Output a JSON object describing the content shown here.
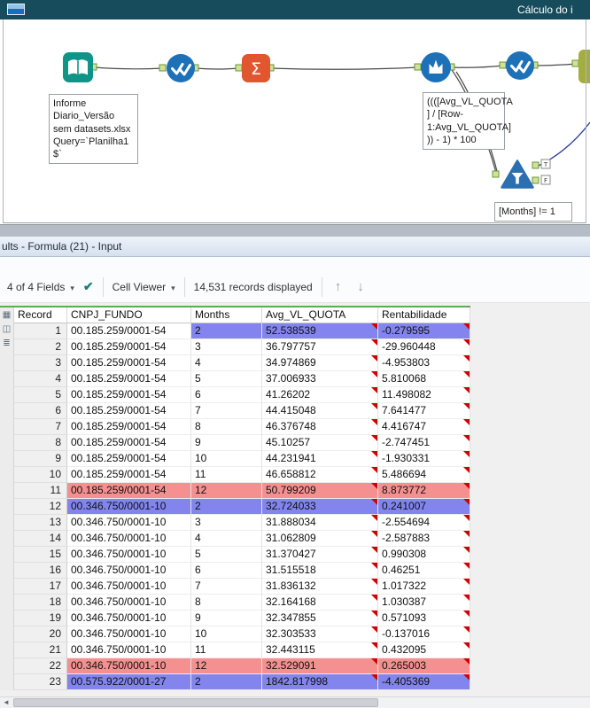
{
  "titlebar": {
    "title": "Cálculo do i"
  },
  "workflow": {
    "tools": [
      {
        "icon": "input-data-icon"
      },
      {
        "icon": "select-icon"
      },
      {
        "icon": "summarize-icon"
      },
      {
        "icon": "multi-row-formula-icon"
      },
      {
        "icon": "select-icon"
      },
      {
        "icon": "filter-icon"
      }
    ],
    "annotations": {
      "input": "Informe\nDiario_Versão\nsem datasets.xlsx\nQuery=`Planilha1\n$`",
      "formula": "((([Avg_VL_QUOTA\n] / [Row-\n1:Avg_VL_QUOTA]\n)) - 1) * 100",
      "filter": "[Months] != 1"
    },
    "filter_outputs": {
      "true_label": "T",
      "false_label": "F"
    }
  },
  "results": {
    "caption": "ults - Formula (21) - Input",
    "toolbar": {
      "fields": "4 of 4 Fields",
      "cell_viewer": "Cell Viewer",
      "records": "14,531 records displayed"
    },
    "table": {
      "columns": [
        "Record",
        "CNPJ_FUNDO",
        "Months",
        "Avg_VL_QUOTA",
        "Rentabilidade"
      ],
      "rows": [
        {
          "record": 1,
          "cnpj": "00.185.259/0001-54",
          "months": "2",
          "avg": "52.538539",
          "rent": "-0.279595",
          "highlight": "blue",
          "highlight_cnpj": false
        },
        {
          "record": 2,
          "cnpj": "00.185.259/0001-54",
          "months": "3",
          "avg": "36.797757",
          "rent": "-29.960448",
          "highlight": null,
          "highlight_cnpj": false
        },
        {
          "record": 3,
          "cnpj": "00.185.259/0001-54",
          "months": "4",
          "avg": "34.974869",
          "rent": "-4.953803",
          "highlight": null,
          "highlight_cnpj": false
        },
        {
          "record": 4,
          "cnpj": "00.185.259/0001-54",
          "months": "5",
          "avg": "37.006933",
          "rent": "5.810068",
          "highlight": null,
          "highlight_cnpj": false
        },
        {
          "record": 5,
          "cnpj": "00.185.259/0001-54",
          "months": "6",
          "avg": "41.26202",
          "rent": "11.498082",
          "highlight": null,
          "highlight_cnpj": false
        },
        {
          "record": 6,
          "cnpj": "00.185.259/0001-54",
          "months": "7",
          "avg": "44.415048",
          "rent": "7.641477",
          "highlight": null,
          "highlight_cnpj": false
        },
        {
          "record": 7,
          "cnpj": "00.185.259/0001-54",
          "months": "8",
          "avg": "46.376748",
          "rent": "4.416747",
          "highlight": null,
          "highlight_cnpj": false
        },
        {
          "record": 8,
          "cnpj": "00.185.259/0001-54",
          "months": "9",
          "avg": "45.10257",
          "rent": "-2.747451",
          "highlight": null,
          "highlight_cnpj": false
        },
        {
          "record": 9,
          "cnpj": "00.185.259/0001-54",
          "months": "10",
          "avg": "44.231941",
          "rent": "-1.930331",
          "highlight": null,
          "highlight_cnpj": false
        },
        {
          "record": 10,
          "cnpj": "00.185.259/0001-54",
          "months": "11",
          "avg": "46.658812",
          "rent": "5.486694",
          "highlight": null,
          "highlight_cnpj": false
        },
        {
          "record": 11,
          "cnpj": "00.185.259/0001-54",
          "months": "12",
          "avg": "50.799209",
          "rent": "8.873772",
          "highlight": "red",
          "highlight_cnpj": true
        },
        {
          "record": 12,
          "cnpj": "00.346.750/0001-10",
          "months": "2",
          "avg": "32.724033",
          "rent": "0.241007",
          "highlight": "blue",
          "highlight_cnpj": true
        },
        {
          "record": 13,
          "cnpj": "00.346.750/0001-10",
          "months": "3",
          "avg": "31.888034",
          "rent": "-2.554694",
          "highlight": null,
          "highlight_cnpj": false
        },
        {
          "record": 14,
          "cnpj": "00.346.750/0001-10",
          "months": "4",
          "avg": "31.062809",
          "rent": "-2.587883",
          "highlight": null,
          "highlight_cnpj": false
        },
        {
          "record": 15,
          "cnpj": "00.346.750/0001-10",
          "months": "5",
          "avg": "31.370427",
          "rent": "0.990308",
          "highlight": null,
          "highlight_cnpj": false
        },
        {
          "record": 16,
          "cnpj": "00.346.750/0001-10",
          "months": "6",
          "avg": "31.515518",
          "rent": "0.46251",
          "highlight": null,
          "highlight_cnpj": false
        },
        {
          "record": 17,
          "cnpj": "00.346.750/0001-10",
          "months": "7",
          "avg": "31.836132",
          "rent": "1.017322",
          "highlight": null,
          "highlight_cnpj": false
        },
        {
          "record": 18,
          "cnpj": "00.346.750/0001-10",
          "months": "8",
          "avg": "32.164168",
          "rent": "1.030387",
          "highlight": null,
          "highlight_cnpj": false
        },
        {
          "record": 19,
          "cnpj": "00.346.750/0001-10",
          "months": "9",
          "avg": "32.347855",
          "rent": "0.571093",
          "highlight": null,
          "highlight_cnpj": false
        },
        {
          "record": 20,
          "cnpj": "00.346.750/0001-10",
          "months": "10",
          "avg": "32.303533",
          "rent": "-0.137016",
          "highlight": null,
          "highlight_cnpj": false
        },
        {
          "record": 21,
          "cnpj": "00.346.750/0001-10",
          "months": "11",
          "avg": "32.443115",
          "rent": "0.432095",
          "highlight": null,
          "highlight_cnpj": false
        },
        {
          "record": 22,
          "cnpj": "00.346.750/0001-10",
          "months": "12",
          "avg": "32.529091",
          "rent": "0.265003",
          "highlight": "red",
          "highlight_cnpj": true
        },
        {
          "record": 23,
          "cnpj": "00.575.922/0001-27",
          "months": "2",
          "avg": "1842.817998",
          "rent": "-4.405369",
          "highlight": "blue",
          "highlight_cnpj": true
        }
      ]
    }
  },
  "icons": {
    "dropdown_caret": "▾",
    "apply_check": "✔",
    "scroll_up": "↑",
    "scroll_down": "↓",
    "scroll_left_arrow": "◄",
    "rail_table": "▦",
    "rail_profile": "◫",
    "rail_list": "≣",
    "sigma": "Σ"
  },
  "colors": {
    "titlebar_bg": "#174c5c",
    "highlight_blue": "#8384ee",
    "highlight_red": "#f59090",
    "indicator_red": "#d40000",
    "accent_green": "#5aad53",
    "tool_blue": "#1d71b8",
    "tool_orange": "#e0572f",
    "tool_teal": "#0f9488",
    "wire_blue": "#2e3e9e"
  }
}
